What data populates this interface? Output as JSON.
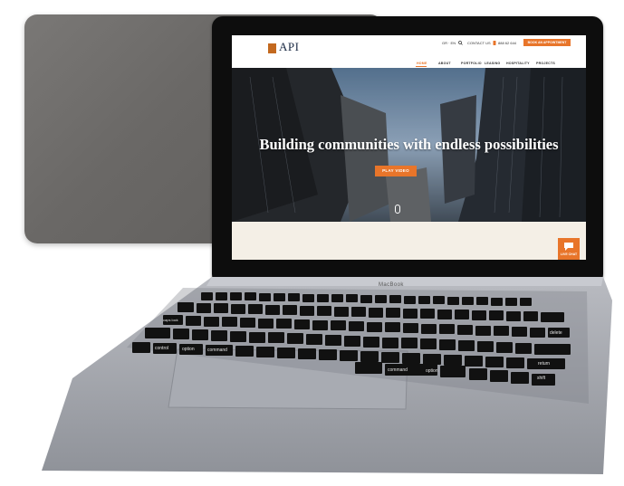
{
  "site": {
    "logo_text": "API",
    "utility_lang": "GR · EN",
    "utility_contact": "CONTACT US",
    "utility_phone": "888 62 644",
    "cta_label": "BOOK AN APPOINTMENT",
    "nav": [
      "HOME",
      "ABOUT",
      "PORTFOLIO",
      "LEASING",
      "HOSPITALITY",
      "PROJECTS"
    ],
    "hero_title": "Building communities with endless possibilities",
    "play_button": "PLAY VIDEO",
    "chat_label": "LIVE CHAT"
  },
  "device": {
    "brand": "MacBook",
    "keys": {
      "caps_lock": "caps lock",
      "control": "control",
      "option_left": "option",
      "command_left": "command",
      "command_right": "command",
      "option_right": "option",
      "shift": "shift",
      "return": "return",
      "delete": "delete"
    }
  },
  "colors": {
    "accent": "#e8752a",
    "navy": "#1b2a44",
    "laptop_gray": "#9ea1a8"
  },
  "icons": [
    "apple-logo-icon",
    "phone-icon",
    "search-icon",
    "chat-icon"
  ]
}
